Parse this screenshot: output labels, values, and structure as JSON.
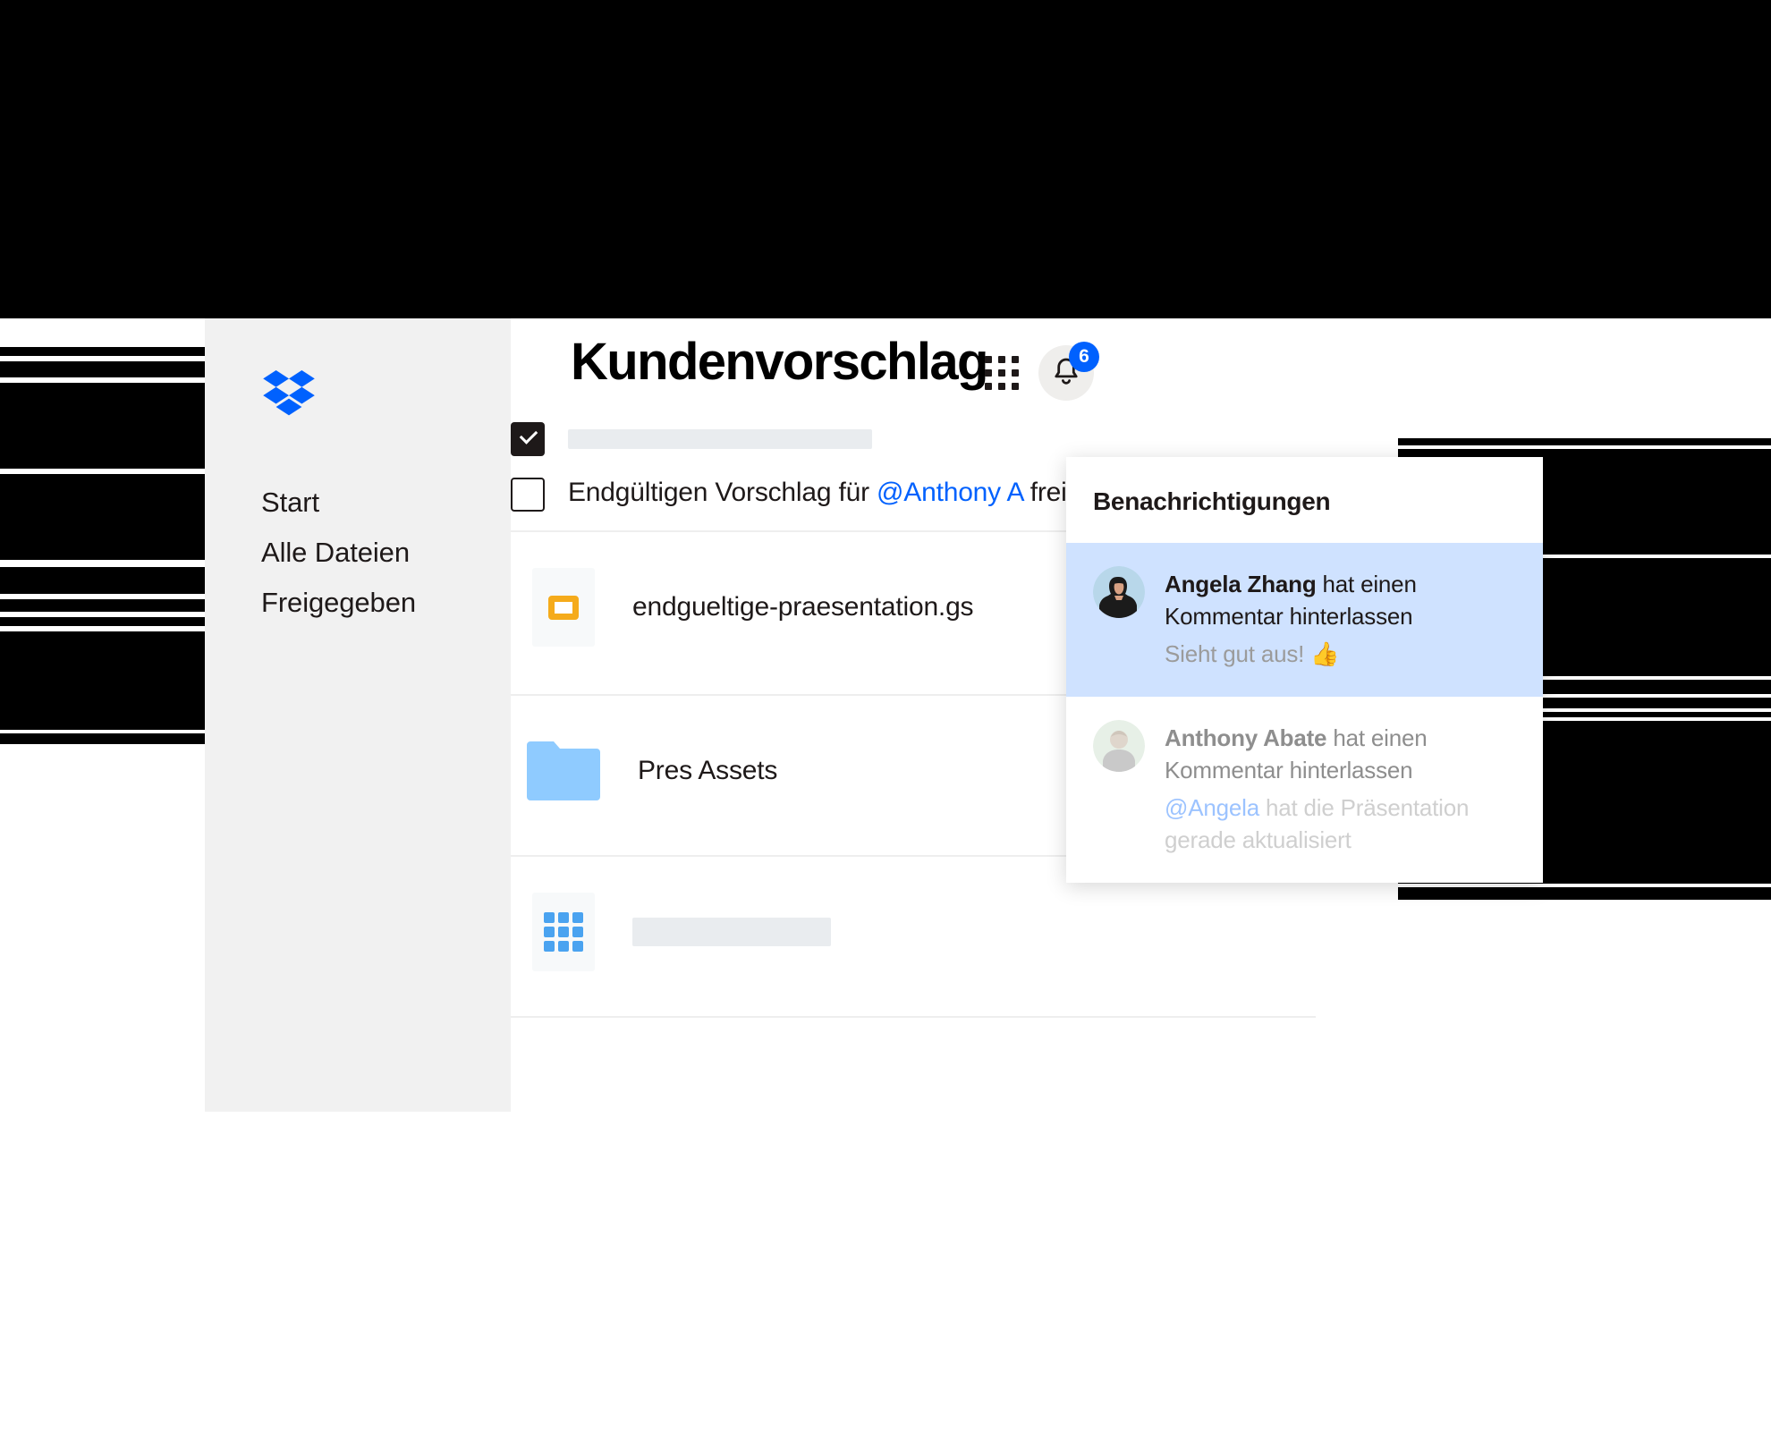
{
  "app": {
    "logo_icon": "dropbox-logo-icon",
    "accent_blue": "#0061fe",
    "sidebar_bg": "#f1f1f1"
  },
  "sidebar": {
    "items": [
      {
        "label": "Start"
      },
      {
        "label": "Alle Dateien"
      },
      {
        "label": "Freigegeben"
      }
    ]
  },
  "header": {
    "title": "Kundenvorschlag",
    "apps_icon": "grid-apps-icon",
    "bell_icon": "bell-icon",
    "badge_count": "6"
  },
  "tasks": [
    {
      "checked": true,
      "placeholder": true,
      "text": ""
    },
    {
      "checked": false,
      "placeholder": false,
      "text_before": "Endgültigen Vorschlag für ",
      "mention": "@Anthony A",
      "text_after": " freigeben"
    }
  ],
  "files": [
    {
      "icon": "google-slides-icon",
      "name": "endgueltige-praesentation.gs",
      "placeholder": false
    },
    {
      "icon": "folder-icon",
      "name": "Pres Assets",
      "placeholder": false
    },
    {
      "icon": "google-sheets-icon",
      "name": "",
      "placeholder": true
    }
  ],
  "notifications": {
    "title": "Benachrichtigungen",
    "items": [
      {
        "avatar": "avatar-angela-zhang",
        "actor": "Angela Zhang",
        "action": " hat einen Kommentar hinterlassen",
        "comment_prefix": "",
        "comment_mention": "",
        "comment": "Sieht gut aus! 👍",
        "unread": true
      },
      {
        "avatar": "avatar-anthony-abate",
        "actor": "Anthony Abate",
        "action": " hat einen Kommentar hinterlassen",
        "comment_prefix": "",
        "comment_mention": "@Angela",
        "comment": " hat die Präsentation gerade aktualisiert",
        "unread": false
      }
    ]
  }
}
